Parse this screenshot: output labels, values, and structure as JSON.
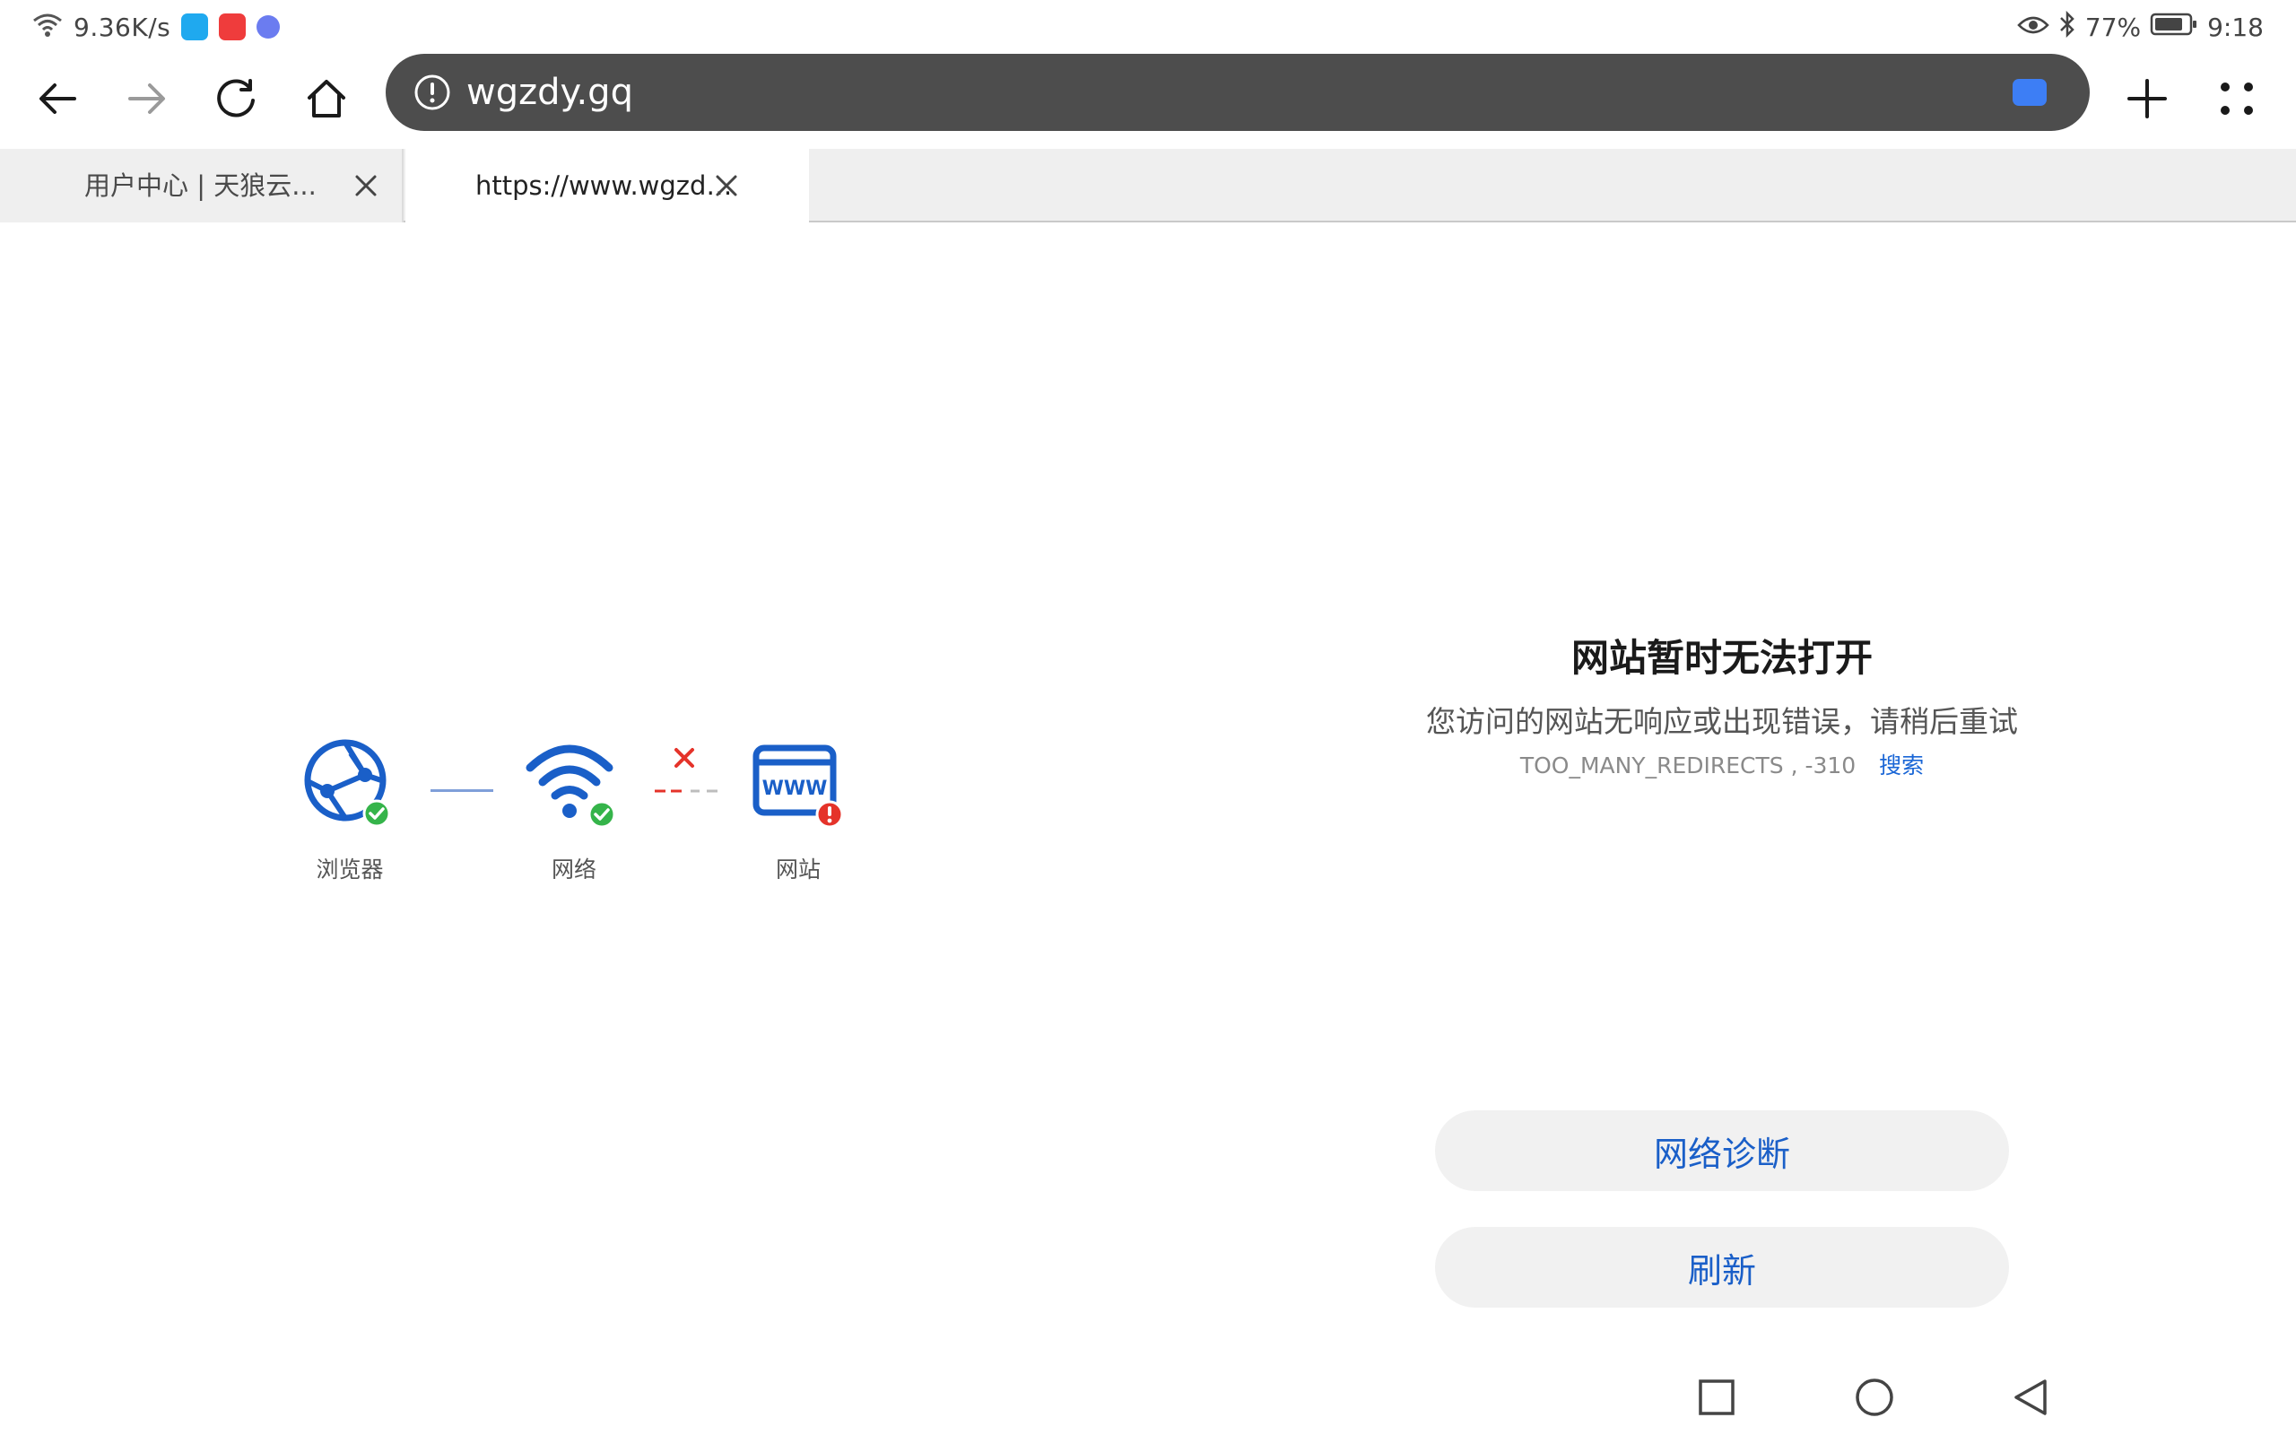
{
  "status_bar": {
    "net_speed": "9.36K/s",
    "battery": "77%",
    "time": "9:18",
    "apps": [
      "qq-browser-icon",
      "red-app-icon",
      "music-icon"
    ]
  },
  "toolbar": {
    "url": "wgzdy.gq",
    "icons": [
      "back-icon",
      "forward-icon",
      "reload-icon",
      "home-icon",
      "info-icon",
      "add-tab-icon",
      "menu-icon"
    ]
  },
  "tabs": [
    {
      "title": "用户中心 | 天狼云...",
      "active": false
    },
    {
      "title": "https://www.wgzdy.…",
      "active": true
    }
  ],
  "diagram": {
    "nodes": [
      {
        "label": "浏览器",
        "status": "ok"
      },
      {
        "label": "网络",
        "status": "ok"
      },
      {
        "label": "网站",
        "status": "error"
      }
    ],
    "www_text": "WWW"
  },
  "error": {
    "title": "网站暂时无法打开",
    "description": "您访问的网站无响应或出现错误，请稍后重试",
    "code": "TOO_MANY_REDIRECTS , -310",
    "search_link": "搜索"
  },
  "buttons": {
    "diagnose": "网络诊断",
    "refresh": "刷新"
  },
  "colors": {
    "accent_blue": "#1a5fc8",
    "ok_green": "#35b44a",
    "error_red": "#e5332a",
    "url_bar": "#4d4d4d"
  }
}
